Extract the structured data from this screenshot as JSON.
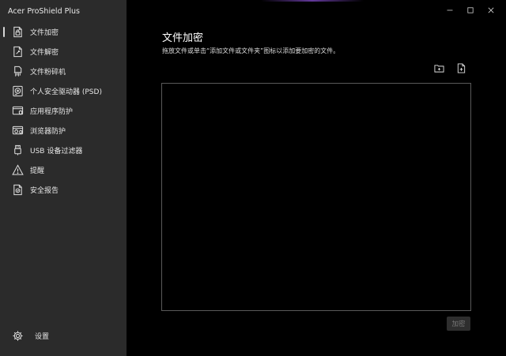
{
  "app": {
    "title": "Acer ProShield Plus"
  },
  "window_controls": [
    {
      "name": "minimize-button",
      "icon": "minimize-icon"
    },
    {
      "name": "maximize-button",
      "icon": "maximize-icon"
    },
    {
      "name": "close-button",
      "icon": "close-icon"
    }
  ],
  "sidebar": {
    "items": [
      {
        "label": "文件加密",
        "icon": "file-lock-icon",
        "active": true
      },
      {
        "label": "文件解密",
        "icon": "file-unlock-icon",
        "active": false
      },
      {
        "label": "文件粉碎机",
        "icon": "file-shredder-icon",
        "active": false
      },
      {
        "label": "个人安全驱动器 (PSD)",
        "icon": "secure-drive-icon",
        "active": false
      },
      {
        "label": "应用程序防护",
        "icon": "app-protect-icon",
        "active": false
      },
      {
        "label": "浏览器防护",
        "icon": "browser-protect-icon",
        "active": false
      },
      {
        "label": "USB 设备过滤器",
        "icon": "usb-icon",
        "active": false
      },
      {
        "label": "提醒",
        "icon": "warning-icon",
        "active": false
      },
      {
        "label": "安全报告",
        "icon": "security-report-icon",
        "active": false
      }
    ],
    "settings_label": "设置",
    "settings_icon": "gear-icon"
  },
  "main": {
    "title": "文件加密",
    "subtitle": "拖放文件或单击“添加文件或文件夹”图标以添加要加密的文件。",
    "add_folder_icon": "add-folder-icon",
    "add_file_icon": "add-file-icon",
    "encrypt_label": "加密"
  },
  "colors": {
    "sidebar_bg": "#2b2b2b",
    "main_bg": "#000000",
    "border": "#5a5a5a",
    "disabled_button_bg": "#2e2e2e",
    "disabled_button_text": "#777777"
  }
}
